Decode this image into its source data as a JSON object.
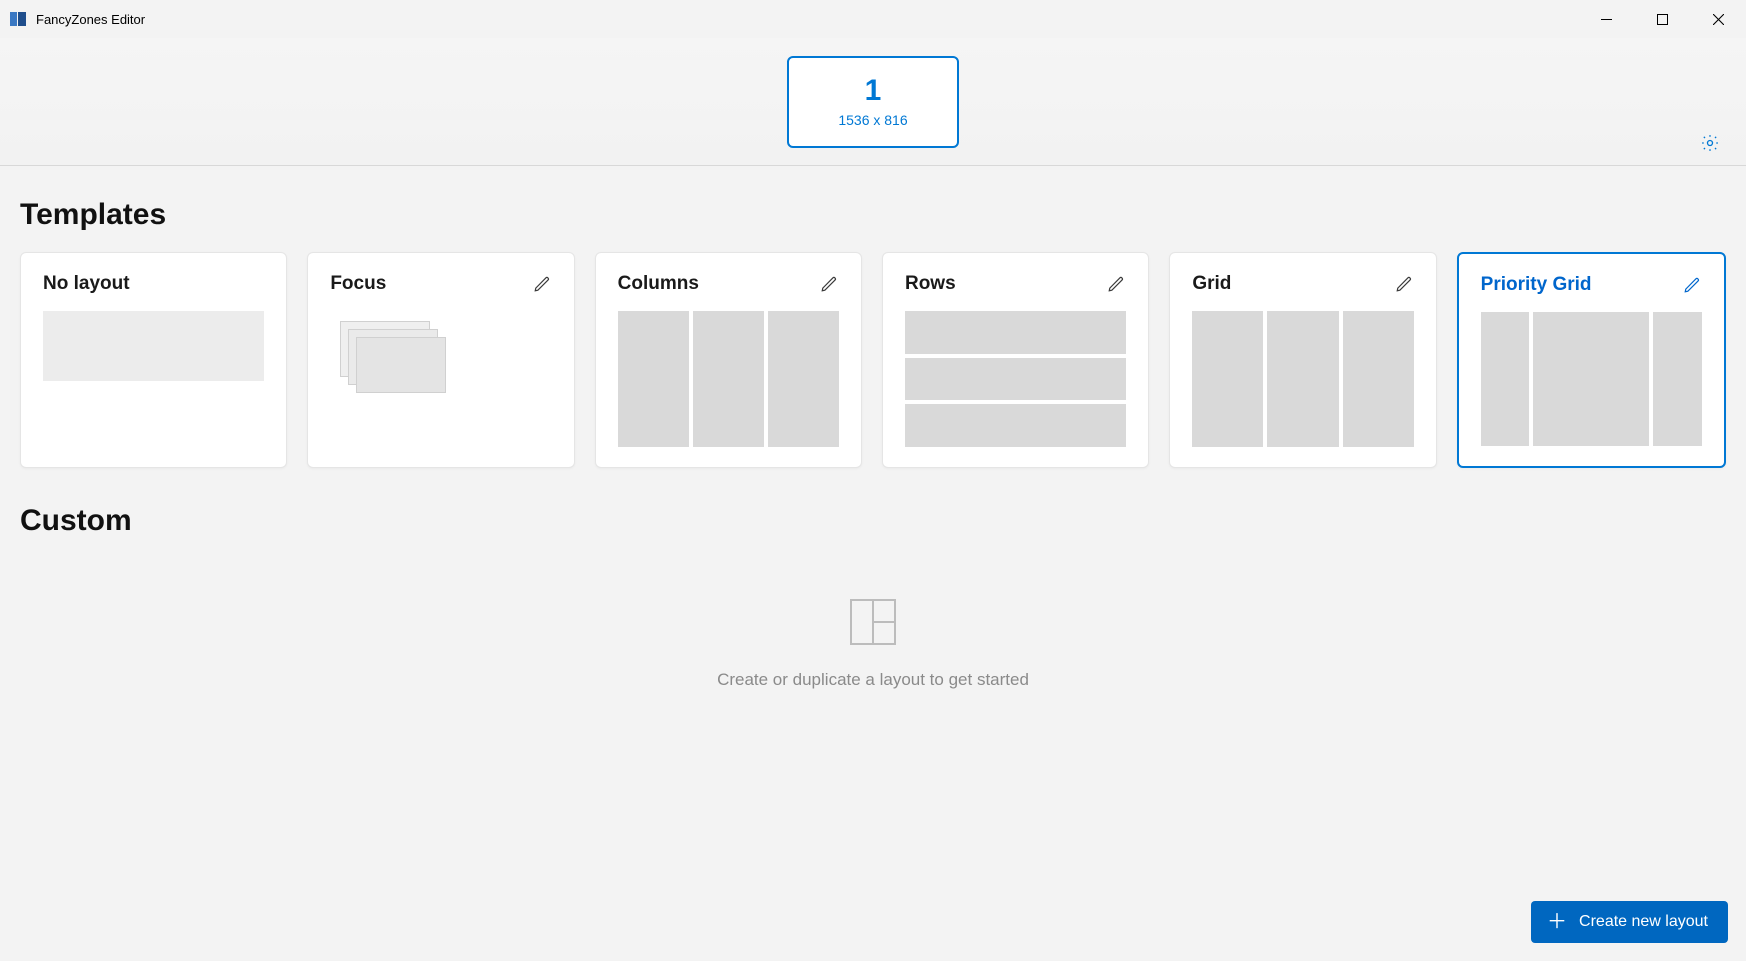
{
  "window": {
    "title": "FancyZones Editor"
  },
  "monitor": {
    "number": "1",
    "resolution": "1536 x 816"
  },
  "sections": {
    "templates": "Templates",
    "custom": "Custom"
  },
  "templates": [
    {
      "name": "No layout",
      "editable": false,
      "selected": false
    },
    {
      "name": "Focus",
      "editable": true,
      "selected": false
    },
    {
      "name": "Columns",
      "editable": true,
      "selected": false
    },
    {
      "name": "Rows",
      "editable": true,
      "selected": false
    },
    {
      "name": "Grid",
      "editable": true,
      "selected": false
    },
    {
      "name": "Priority Grid",
      "editable": true,
      "selected": true
    }
  ],
  "custom_empty": {
    "message": "Create or duplicate a layout to get started"
  },
  "buttons": {
    "create_new_layout": "Create new layout"
  },
  "colors": {
    "accent": "#0078d4",
    "button": "#0067c0"
  }
}
